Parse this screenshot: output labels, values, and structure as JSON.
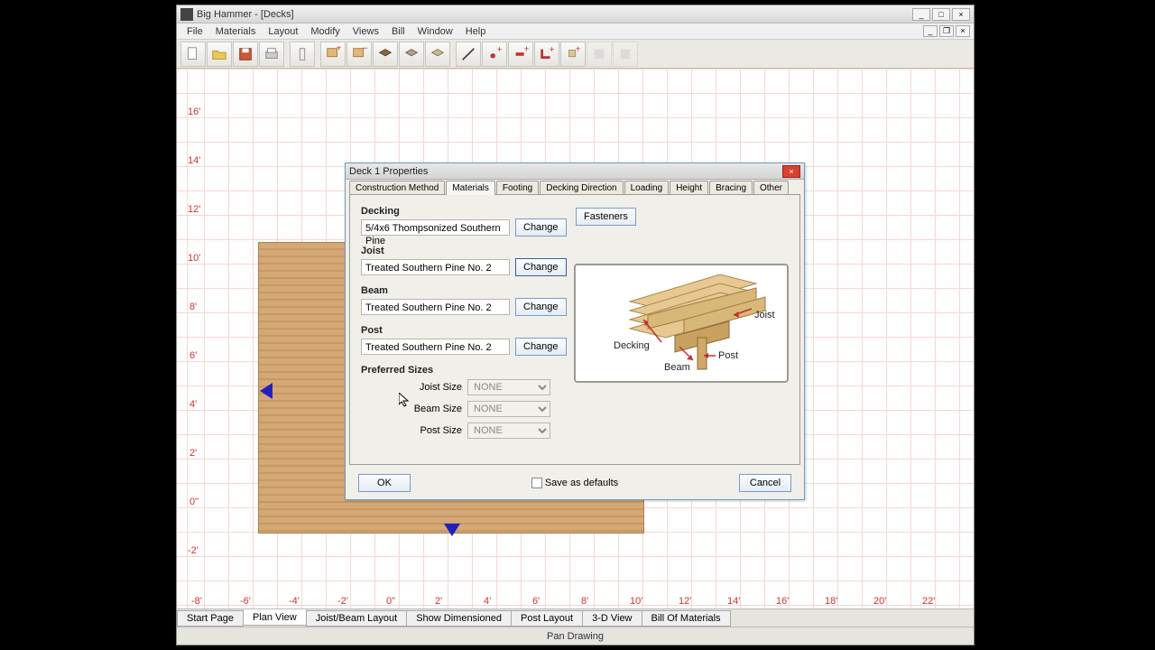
{
  "window": {
    "title": "Big Hammer - [Decks]"
  },
  "menu": {
    "items": [
      "File",
      "Materials",
      "Layout",
      "Modify",
      "Views",
      "Bill",
      "Window",
      "Help"
    ]
  },
  "ruler_y": [
    "16'",
    "14'",
    "12'",
    "10'",
    "8'",
    "6'",
    "4'",
    "2'",
    "0\"",
    "-2'"
  ],
  "ruler_x": [
    "-8'",
    "-6'",
    "-4'",
    "-2'",
    "0\"",
    "2'",
    "4'",
    "6'",
    "8'",
    "10'",
    "12'",
    "14'",
    "16'",
    "18'",
    "20'",
    "22'"
  ],
  "bottom_tabs": [
    "Start Page",
    "Plan View",
    "Joist/Beam Layout",
    "Show  Dimensioned",
    "Post Layout",
    "3-D View",
    "Bill Of Materials"
  ],
  "active_bottom_tab": 1,
  "status": "Pan Drawing",
  "dialog": {
    "title": "Deck 1 Properties",
    "tabs": [
      "Construction Method",
      "Materials",
      "Footing",
      "Decking Direction",
      "Loading",
      "Height",
      "Bracing",
      "Other"
    ],
    "active_tab": 1,
    "decking": {
      "label": "Decking",
      "value": "5/4x6 Thompsonized Southern Pine",
      "change": "Change"
    },
    "joist": {
      "label": "Joist",
      "value": "Treated Southern Pine No. 2",
      "change": "Change"
    },
    "beam": {
      "label": "Beam",
      "value": "Treated Southern Pine No. 2",
      "change": "Change"
    },
    "post": {
      "label": "Post",
      "value": "Treated Southern Pine No. 2",
      "change": "Change"
    },
    "fasteners": "Fasteners",
    "preferred": {
      "heading": "Preferred Sizes",
      "joist": {
        "label": "Joist Size",
        "value": "NONE"
      },
      "beam": {
        "label": "Beam Size",
        "value": "NONE"
      },
      "post": {
        "label": "Post Size",
        "value": "NONE"
      }
    },
    "diagram": {
      "decking": "Decking",
      "joist": "Joist",
      "beam": "Beam",
      "post": "Post"
    },
    "ok": "OK",
    "save_defaults": "Save as defaults",
    "cancel": "Cancel"
  }
}
